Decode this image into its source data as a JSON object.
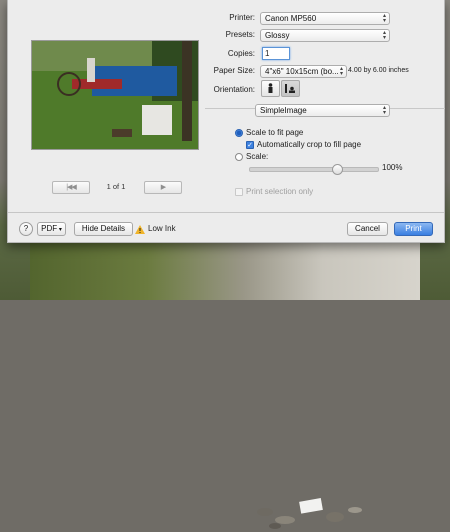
{
  "printer": {
    "label": "Printer:",
    "value": "Canon MP560"
  },
  "presets": {
    "label": "Presets:",
    "value": "Glossy"
  },
  "copies": {
    "label": "Copies:",
    "value": "1"
  },
  "paper_size": {
    "label": "Paper Size:",
    "value": "4\"x6\" 10x15cm (bo...",
    "dims": "4.00 by 6.00 inches"
  },
  "orientation": {
    "label": "Orientation:"
  },
  "app_menu": {
    "value": "SimpleImage"
  },
  "scaling": {
    "fit_label": "Scale to fit page",
    "crop_label": "Automatically crop to fill page",
    "scale_label": "Scale:",
    "scale_value": "100%",
    "scale_fraction": 0.68
  },
  "print_selection_label": "Print selection only",
  "pager": {
    "page_text": "1 of 1",
    "first": "|◀◀",
    "prev": "◀",
    "next": "▶",
    "last": "▶▶|"
  },
  "bottom": {
    "help": "?",
    "pdf": "PDF",
    "hide_details": "Hide Details",
    "ink_warning": "Low Ink",
    "cancel": "Cancel",
    "print": "Print"
  },
  "colors": {
    "accent": "#3a7fe1",
    "warning": "#f0b429"
  }
}
